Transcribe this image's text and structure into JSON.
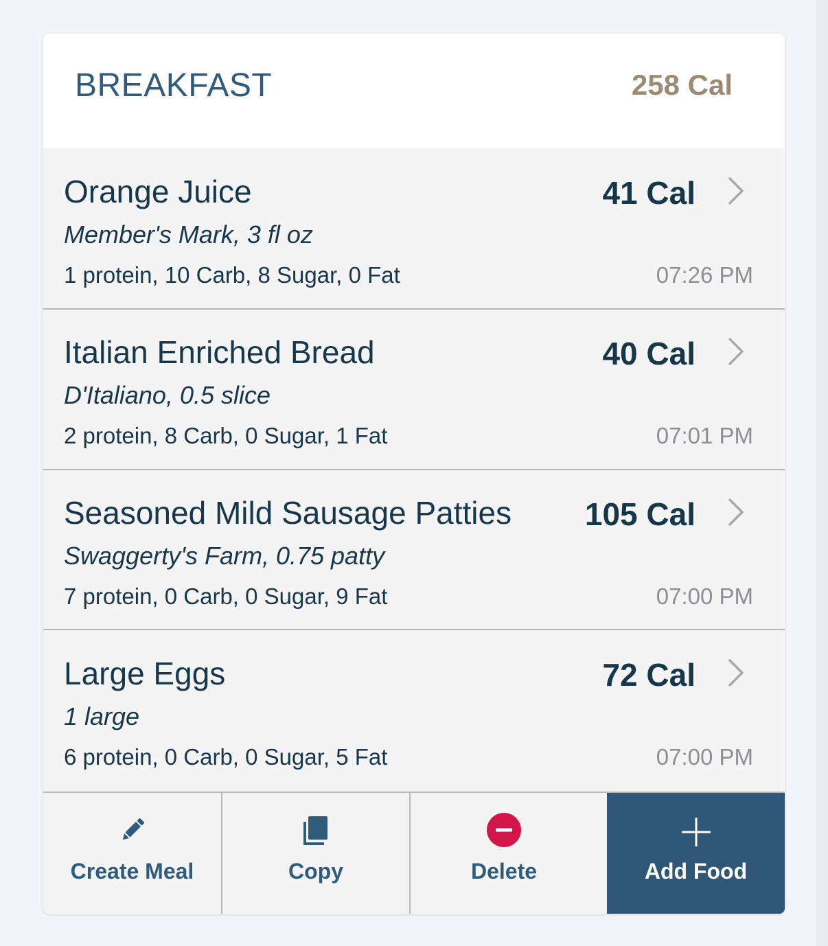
{
  "meal": {
    "title": "BREAKFAST",
    "total": "258 Cal"
  },
  "foods": [
    {
      "name": "Orange Juice",
      "cal": "41 Cal",
      "brand": "Member's Mark, 3 fl oz",
      "macros": "1 protein, 10 Carb, 8 Sugar, 0 Fat",
      "time": "07:26 PM"
    },
    {
      "name": "Italian Enriched Bread",
      "cal": "40 Cal",
      "brand": "D'Italiano, 0.5 slice",
      "macros": "2 protein, 8 Carb, 0 Sugar, 1 Fat",
      "time": "07:01 PM"
    },
    {
      "name": "Seasoned Mild Sausage Patties",
      "cal": "105 Cal",
      "brand": "Swaggerty's Farm, 0.75 patty",
      "macros": "7 protein, 0 Carb, 0 Sugar, 9 Fat",
      "time": "07:00 PM"
    },
    {
      "name": "Large Eggs",
      "cal": "72 Cal",
      "brand": "1 large",
      "macros": "6 protein, 0 Carb, 0 Sugar, 5 Fat",
      "time": "07:00 PM"
    }
  ],
  "toolbar": {
    "create_meal": {
      "label": "Create Meal",
      "icon": "pencil-icon"
    },
    "copy": {
      "label": "Copy",
      "icon": "copy-icon"
    },
    "delete": {
      "label": "Delete",
      "icon": "minus-circle-icon"
    },
    "add_food": {
      "label": "Add Food",
      "icon": "plus-icon"
    }
  },
  "colors": {
    "header_title": "#2f5b7c",
    "total_cal": "#9a8b73",
    "primary_text": "#17374a",
    "time_text": "#8e8e93",
    "delete_red": "#d4154c",
    "add_button_bg": "#2f5577"
  }
}
